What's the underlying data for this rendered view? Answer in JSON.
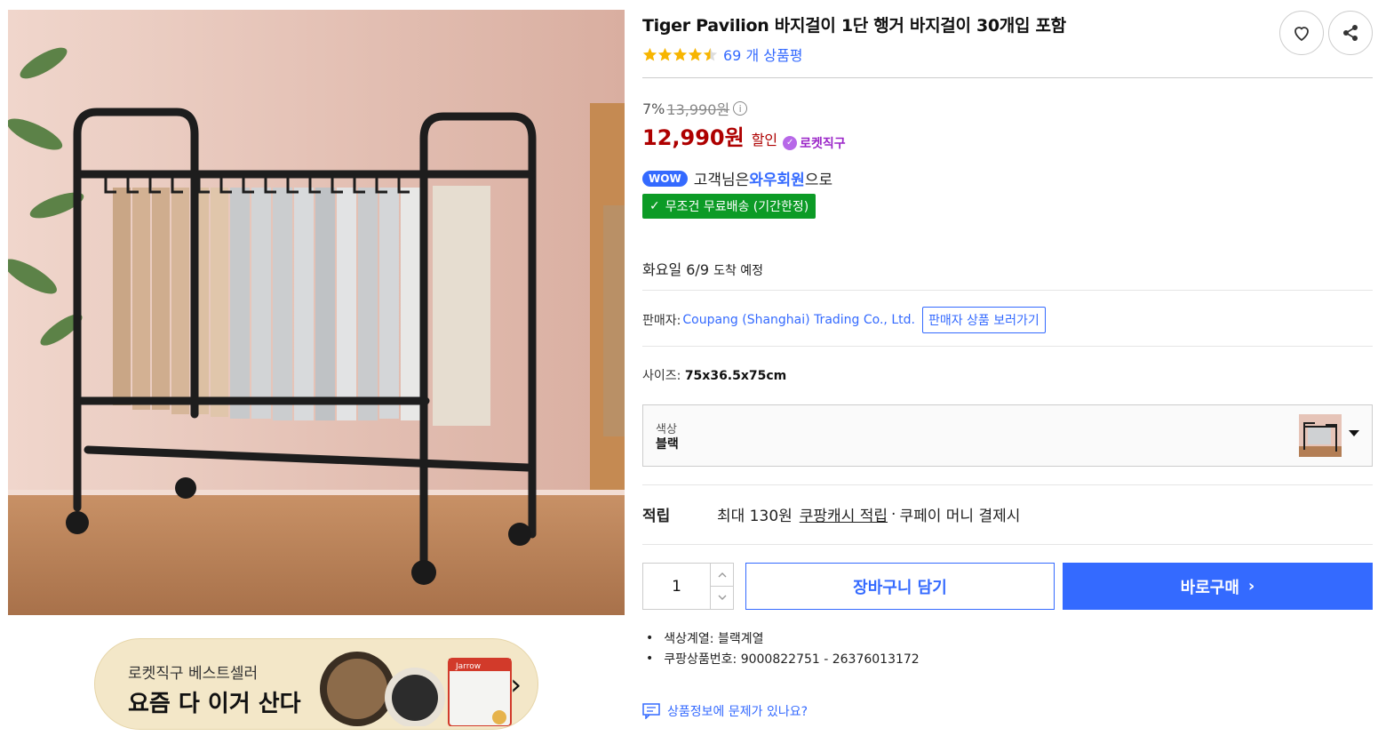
{
  "product": {
    "title": "Tiger Pavilion 바지걸이 1단 행거 바지걸이 30개입 포함",
    "rating": 4.5,
    "review_count": "69 개 상품평"
  },
  "price": {
    "discount_rate": "7%",
    "original_price": "13,990원",
    "sale_price": "12,990원",
    "sale_label": "할인",
    "rocket_label": "로켓직구"
  },
  "wow": {
    "pill": "WOW",
    "prefix": "고객님은",
    "member": "와우회원",
    "suffix": "으로",
    "free_shipping": "무조건 무료배송 (기간한정)"
  },
  "delivery": {
    "day": "화요일 6/9",
    "suffix": "도착 예정"
  },
  "seller": {
    "label": "판매자:",
    "name": "Coupang (Shanghai) Trading Co., Ltd.",
    "button": "판매자 상품 보러가기"
  },
  "size": {
    "label": "사이즈:",
    "value": "75x36.5x75cm"
  },
  "option": {
    "label": "색상",
    "value": "블랙"
  },
  "points": {
    "label": "적립",
    "amount": "최대 130원",
    "link": "쿠팡캐시 적립",
    "dot": "·",
    "tail": "쿠페이 머니 결제시"
  },
  "purchase": {
    "quantity": "1",
    "cart_label": "장바구니 담기",
    "buy_label": "바로구매"
  },
  "details": [
    "색상계열: 블랙계열",
    "쿠팡상품번호: 9000822751 - 26376013172"
  ],
  "report_label": "상품정보에 문제가 있나요?",
  "banner": {
    "line1": "로켓직구 베스트셀러",
    "line2": "요즘 다 이거 산다",
    "product_label": "Jarrow"
  },
  "colors": {
    "accent": "#346aff",
    "price": "#ae0000",
    "free_shipping": "#0c9b26",
    "rocket": "#9b26c8",
    "star": "#f7b500"
  }
}
